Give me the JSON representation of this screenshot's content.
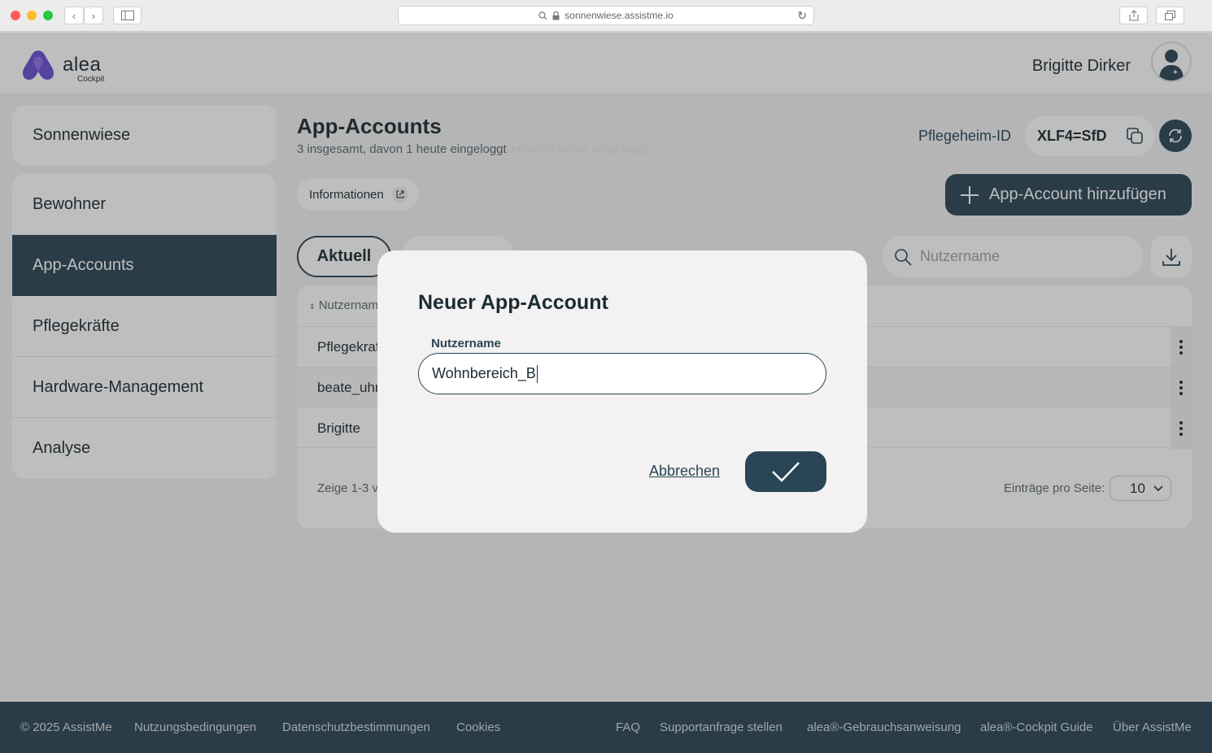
{
  "browser": {
    "url": "sonnenwiese.assistme.io"
  },
  "header": {
    "logo_text": "alea",
    "logo_sub": "Cockpit",
    "user_name": "Brigitte Dirker"
  },
  "sidebar": {
    "home": "Sonnenwiese",
    "items": [
      {
        "label": "Bewohner"
      },
      {
        "label": "App-Accounts"
      },
      {
        "label": "Pflegekräfte"
      },
      {
        "label": "Hardware-Management"
      },
      {
        "label": "Analyse"
      }
    ]
  },
  "page": {
    "title": "App-Accounts",
    "subtitle": "3 insgesamt, davon 1 heute eingeloggt",
    "subtitle_ghost": "eCount} heute eingeloggt",
    "pid_label": "Pflegeheim-ID",
    "pid_value": "XLF4=SfD",
    "info_label": "Informationen",
    "add_label": "App-Account hinzufügen",
    "tab_current": "Aktuell",
    "search_placeholder": "Nutzername"
  },
  "table": {
    "header": "Nutzernam",
    "rows": [
      {
        "name": "Pflegekraf"
      },
      {
        "name": "beate_uhr"
      },
      {
        "name": "Brigitte"
      }
    ],
    "paging_text": "Zeige 1-3 vo",
    "per_page_label": "Einträge pro Seite:",
    "per_page_value": "10"
  },
  "modal": {
    "title": "Neuer App-Account",
    "field_label": "Nutzername",
    "field_value": "Wohnbereich_B",
    "cancel_label": "Abbrechen"
  },
  "footer": {
    "copyright": "© 2025 AssistMe",
    "links": [
      "Nutzungsbedingungen",
      "Datenschutzbestimmungen",
      "Cookies",
      "FAQ",
      "Supportanfrage stellen",
      "alea®-Gebrauchsanweisung",
      "alea®-Cockpit Guide",
      "Über AssistMe"
    ]
  },
  "colors": {
    "primary": "#2a4656",
    "logo": "#6b4fd1"
  }
}
